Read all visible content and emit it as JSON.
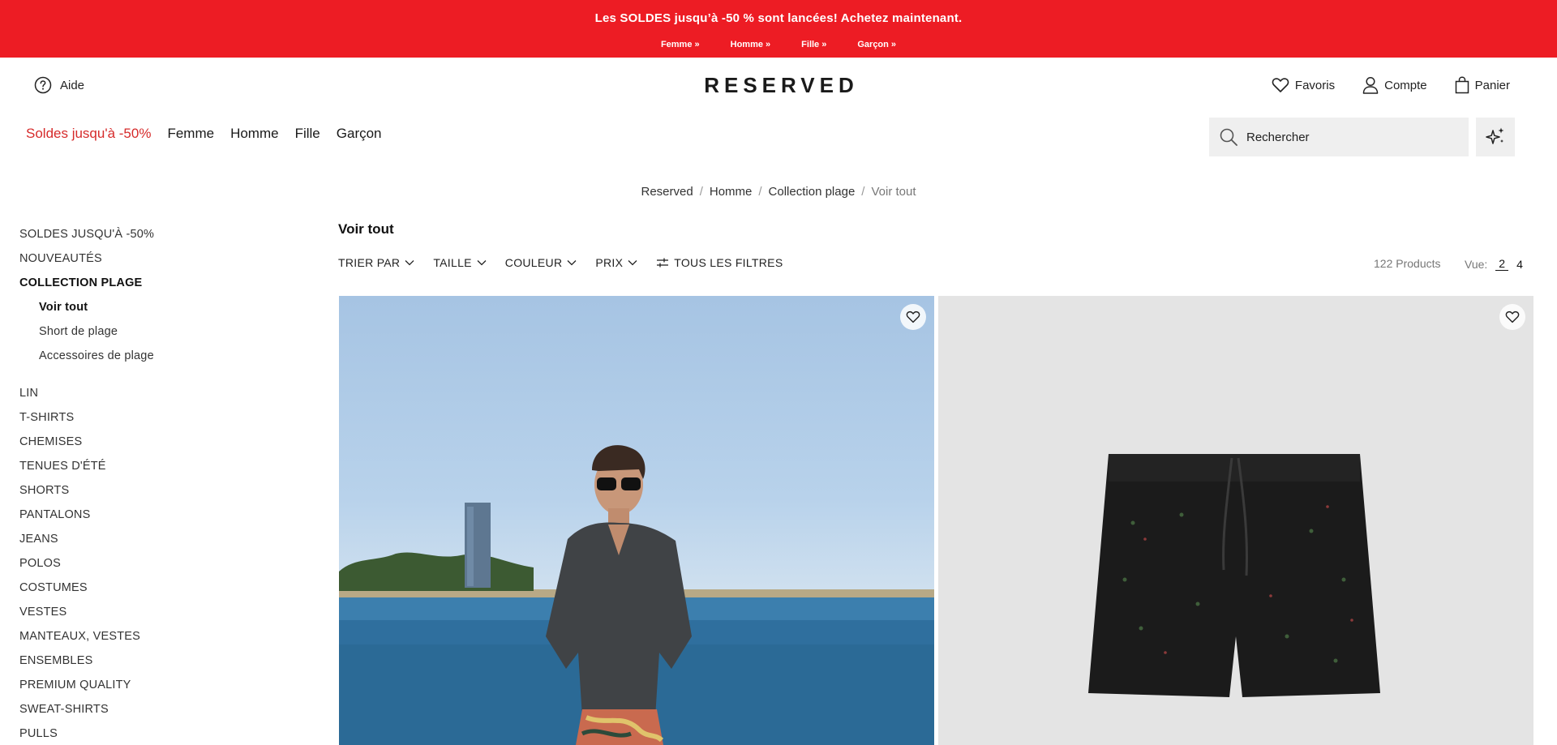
{
  "promo": {
    "text": "Les SOLDES jusqu’à -50 % sont lancées! Achetez maintenant.",
    "links": [
      "Femme »",
      "Homme »",
      "Fille »",
      "Garçon »"
    ],
    "color": "#ed1c24"
  },
  "header": {
    "help_label": "Aide",
    "logo": "RESERVED",
    "favorites_label": "Favoris",
    "account_label": "Compte",
    "cart_label": "Panier"
  },
  "nav": {
    "sale": "Soldes jusqu'à -50%",
    "women": "Femme",
    "men": "Homme",
    "girl": "Fille",
    "boy": "Garçon"
  },
  "search": {
    "placeholder": "Rechercher"
  },
  "breadcrumb": [
    "Reserved",
    "Homme",
    "Collection plage",
    "Voir tout"
  ],
  "sidebar": {
    "sale": "SOLDES JUSQU'À -50%",
    "new": "NOUVEAUTÉS",
    "beach": "COLLECTION PLAGE",
    "sub": [
      "Voir tout",
      "Short de plage",
      "Accessoires de plage"
    ],
    "categories": [
      "LIN",
      "T-SHIRTS",
      "CHEMISES",
      "TENUES D'ÉTÉ",
      "SHORTS",
      "PANTALONS",
      "JEANS",
      "POLOS",
      "COSTUMES",
      "VESTES",
      "MANTEAUX, VESTES",
      "ENSEMBLES",
      "PREMIUM QUALITY",
      "SWEAT-SHIRTS",
      "PULLS"
    ]
  },
  "content": {
    "title": "Voir tout",
    "filters": [
      "TRIER PAR",
      "TAILLE",
      "COULEUR",
      "PRIX"
    ],
    "all_filters": "TOUS LES FILTRES",
    "count": "122 Products",
    "view_label": "Vue:",
    "view_options": [
      "2",
      "4"
    ]
  },
  "icons": {
    "help": "question-circle-icon",
    "favorites": "heart-icon",
    "account": "user-icon",
    "cart": "bag-icon",
    "search": "search-icon",
    "ai": "sparkle-icon",
    "wishlist": "heart-icon"
  }
}
